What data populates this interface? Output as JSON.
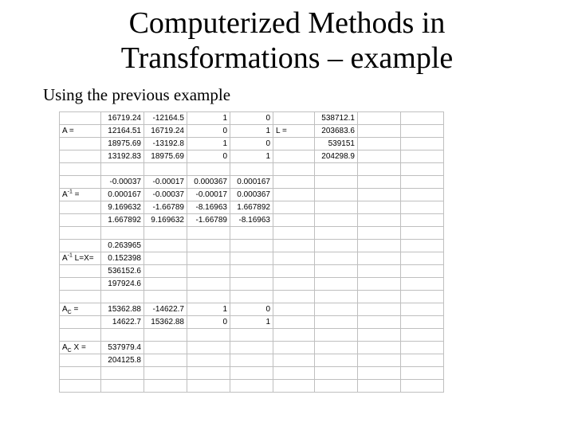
{
  "title_line1": "Computerized Methods in",
  "title_line2": "Transformations – example",
  "subtitle": "Using the previous example",
  "labels": {
    "A": "A =",
    "Ainv_pre": "A",
    "Ainv_sup": "-1",
    "Ainv_post": " =",
    "AinvLX_pre": "A",
    "AinvLX_sup": "-1",
    "AinvLX_post": " L=X=",
    "L": "L =",
    "Ac_pre": "A",
    "Ac_sub": "C",
    "Ac_post": " =",
    "AcX_pre": "A",
    "AcX_sub": "C",
    "AcX_post": " X =",
    "empty": ""
  },
  "grid": {
    "r1": [
      "16719.24",
      "-12164.5",
      "1",
      "0",
      "",
      "538712.1",
      "",
      ""
    ],
    "r2": [
      "12164.51",
      "16719.24",
      "0",
      "1",
      "",
      "203683.6",
      "",
      ""
    ],
    "r3": [
      "18975.69",
      "-13192.8",
      "1",
      "0",
      "",
      "539151",
      "",
      ""
    ],
    "r4": [
      "13192.83",
      "18975.69",
      "0",
      "1",
      "",
      "204298.9",
      "",
      ""
    ],
    "r5": [
      "",
      "",
      "",
      "",
      "",
      "",
      "",
      ""
    ],
    "r6": [
      "-0.00037",
      "-0.00017",
      "0.000367",
      "0.000167",
      "",
      "",
      "",
      ""
    ],
    "r7": [
      "0.000167",
      "-0.00037",
      "-0.00017",
      "0.000367",
      "",
      "",
      "",
      ""
    ],
    "r8": [
      "9.169632",
      "-1.66789",
      "-8.16963",
      "1.667892",
      "",
      "",
      "",
      ""
    ],
    "r9": [
      "1.667892",
      "9.169632",
      "-1.66789",
      "-8.16963",
      "",
      "",
      "",
      ""
    ],
    "r10": [
      "",
      "",
      "",
      "",
      "",
      "",
      "",
      ""
    ],
    "r11": [
      "0.263965",
      "",
      "",
      "",
      "",
      "",
      "",
      ""
    ],
    "r12": [
      "0.152398",
      "",
      "",
      "",
      "",
      "",
      "",
      ""
    ],
    "r13": [
      "536152.6",
      "",
      "",
      "",
      "",
      "",
      "",
      ""
    ],
    "r14": [
      "197924.6",
      "",
      "",
      "",
      "",
      "",
      "",
      ""
    ],
    "r15": [
      "",
      "",
      "",
      "",
      "",
      "",
      "",
      ""
    ],
    "r16": [
      "15362.88",
      "-14622.7",
      "1",
      "0",
      "",
      "",
      "",
      ""
    ],
    "r17": [
      "14622.7",
      "15362.88",
      "0",
      "1",
      "",
      "",
      "",
      ""
    ],
    "r18": [
      "",
      "",
      "",
      "",
      "",
      "",
      "",
      ""
    ],
    "r19": [
      "537979.4",
      "",
      "",
      "",
      "",
      "",
      "",
      ""
    ],
    "r20": [
      "204125.8",
      "",
      "",
      "",
      "",
      "",
      "",
      ""
    ],
    "r21": [
      "",
      "",
      "",
      "",
      "",
      "",
      "",
      ""
    ],
    "r22": [
      "",
      "",
      "",
      "",
      "",
      "",
      "",
      ""
    ]
  }
}
